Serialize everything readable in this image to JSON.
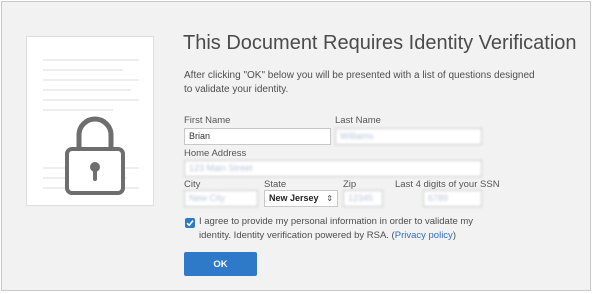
{
  "dialog": {
    "title": "This Document Requires Identity Verification",
    "intro": "After clicking \"OK\" below you will be presented with a list of questions designed to validate your identity."
  },
  "form": {
    "first_name": {
      "label": "First Name",
      "value": "Brian"
    },
    "last_name": {
      "label": "Last Name",
      "value": "Williams"
    },
    "home_address": {
      "label": "Home Address",
      "value": "123 Main Street"
    },
    "city": {
      "label": "City",
      "value": "New City"
    },
    "state": {
      "label": "State",
      "value": "New Jersey"
    },
    "zip": {
      "label": "Zip",
      "value": "12345"
    },
    "ssn_last4": {
      "label": "Last 4 digits of your SSN",
      "value": "6789"
    }
  },
  "consent": {
    "checked": true,
    "text": "I agree to provide my personal information in order to validate my identity. Identity verification powered by RSA. (",
    "link_text": "Privacy policy",
    "text_end": ")"
  },
  "buttons": {
    "ok_label": "OK"
  },
  "icons": {
    "document": "document-icon",
    "lock": "lock-icon",
    "check": "checkmark-icon",
    "state_arrows": "select-arrows-icon"
  },
  "colors": {
    "accent": "#2f79c9",
    "link": "#2d6fc4",
    "background": "#f2f2f2"
  }
}
